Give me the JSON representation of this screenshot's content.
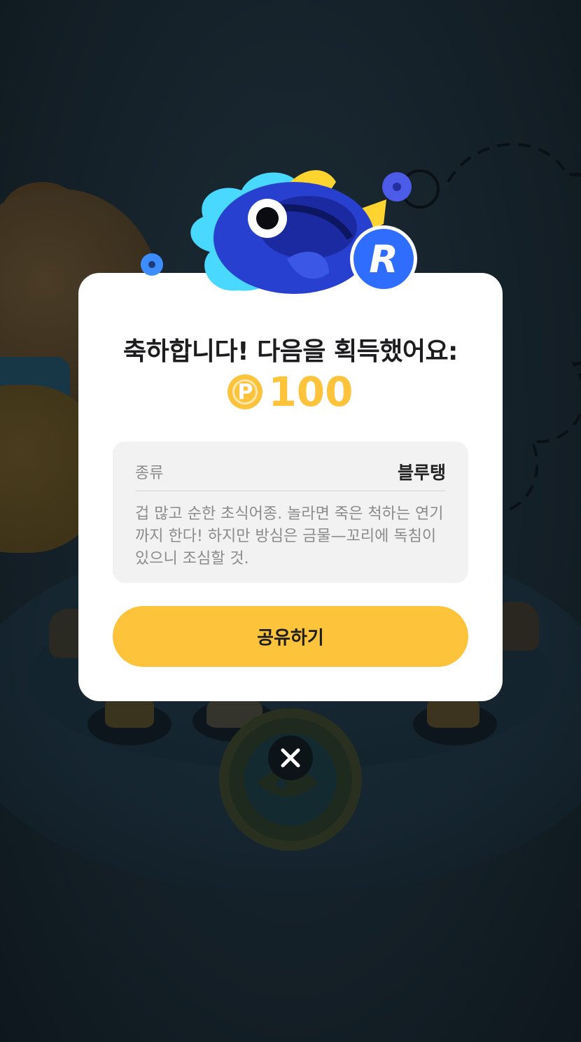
{
  "modal": {
    "title": "축하합니다! 다음을 획득했어요:",
    "reward": {
      "coin_symbol": "P",
      "amount": "100"
    },
    "info": {
      "label": "종류",
      "value": "블루탱",
      "description": "겁 많고 순한 초식어종. 놀라면 죽은 척하는 연기까지 한다! 하지만 방심은 금물—꼬리에 독침이 있으니 조심할 것."
    },
    "share_button": "공유하기",
    "badge_letter": "R"
  },
  "icons": {
    "close": "close-icon",
    "coin": "p-coin-icon",
    "fish": "blue-tang-fish-icon",
    "badge": "r-badge-icon"
  },
  "colors": {
    "accent": "#fcc33b",
    "fish_blue": "#2b3cc9",
    "badge_blue": "#2f6dff",
    "overlay": "#0f1b22"
  }
}
